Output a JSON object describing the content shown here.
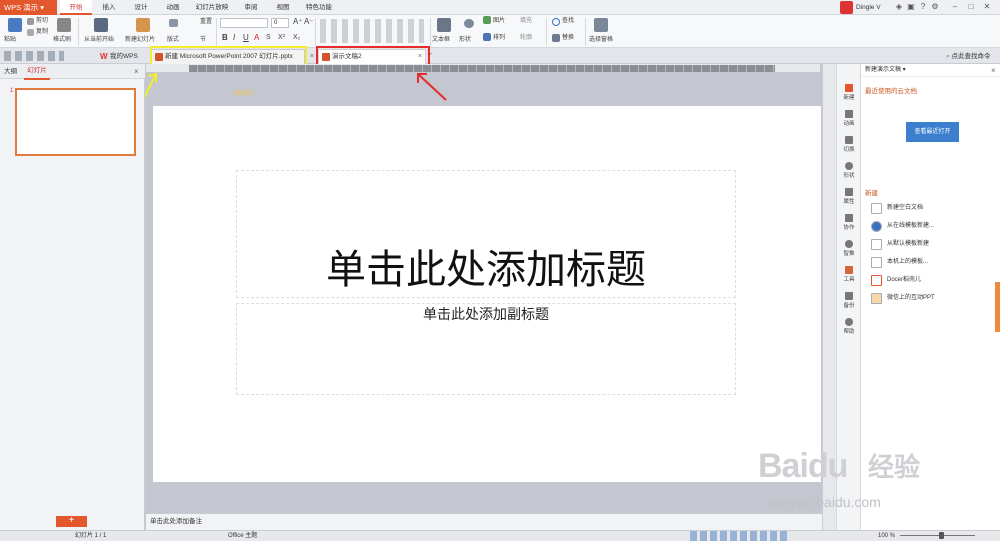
{
  "app": {
    "brand": "WPS 演示",
    "accent": "#e4572c"
  },
  "menu": {
    "tabs": [
      "开始",
      "插入",
      "设计",
      "动画",
      "幻灯片放映",
      "审阅",
      "视图",
      "特色功能"
    ],
    "active": "开始"
  },
  "user": {
    "name": "Dingle V"
  },
  "ribbon": {
    "paste": "粘贴",
    "cut": "剪切",
    "copy": "复制",
    "format_painter": "格式刷",
    "from_current": "从当前开始",
    "new_slide": "新建幻灯片",
    "layout": "版式",
    "section": "节",
    "reset": "重置",
    "font_size": "0",
    "textbox": "文本框",
    "shape": "形状",
    "picture": "图片",
    "fill": "填充",
    "arrange": "排列",
    "outline": "轮廓",
    "find": "查找",
    "replace": "替换",
    "select_pane": "选择窗格"
  },
  "tabs": {
    "my_wps": "我的WPS",
    "doc1": "新建 Microsoft PowerPoint 2007 幻灯片.pptx",
    "doc2": "演示文稿2",
    "search_cmd": "点此查找命令"
  },
  "left_panel": {
    "outline_tab": "大纲",
    "slides_tab": "幻灯片",
    "slide_number": "1"
  },
  "annotation": {
    "note": "原来的"
  },
  "slide": {
    "title_placeholder": "单击此处添加标题",
    "subtitle_placeholder": "单击此处添加副标题"
  },
  "notes_placeholder": "单击此处添加备注",
  "iconbar": [
    "新建",
    "动画",
    "切换",
    "形状",
    "属性",
    "协作",
    "智推",
    "工具",
    "备份",
    "帮助"
  ],
  "taskpane": {
    "header": "新建演示文稿 ▾",
    "cloud_title": "最近使用的云文档",
    "open_recent": "查看最近打开",
    "new_title": "新建",
    "items": [
      "新建空白文档",
      "从在线模板新建...",
      "从默认模板新建",
      "本机上的模板...",
      "Docer稻壳儿",
      "微信上的互动PPT"
    ]
  },
  "status": {
    "slide_info": "幻灯片 1 / 1",
    "theme": "Office 主题",
    "zoom": "100 %",
    "zoom_level_fraction": 0.55
  },
  "watermark": {
    "text1": "Baidu",
    "text2": "经验",
    "text3": "jingyan.baidu.com"
  },
  "icons": [
    "paste-icon",
    "cut-icon",
    "copy-icon",
    "format-painter-icon",
    "play-icon",
    "new-slide-icon",
    "textbox-icon",
    "shape-icon",
    "picture-icon",
    "find-icon",
    "select-pane-icon",
    "close-icon",
    "plus-icon",
    "help-icon"
  ]
}
